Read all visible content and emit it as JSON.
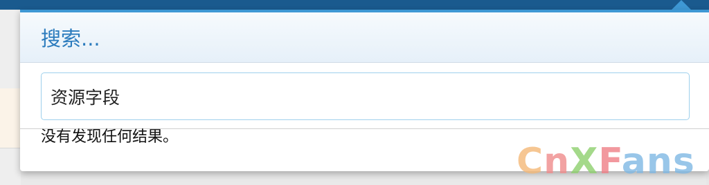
{
  "popup": {
    "title": "搜索...",
    "search": {
      "value": "资源字段",
      "placeholder": ""
    },
    "result_message": "没有发现任何结果。"
  },
  "watermark": {
    "c": "C",
    "n": "n",
    "x": "X",
    "f": "F",
    "rest": "ans"
  },
  "colors": {
    "topbar": "#1a5a8e",
    "accent": "#3e98d4",
    "title": "#2b7bbd",
    "input_border": "#9ed0ec"
  }
}
